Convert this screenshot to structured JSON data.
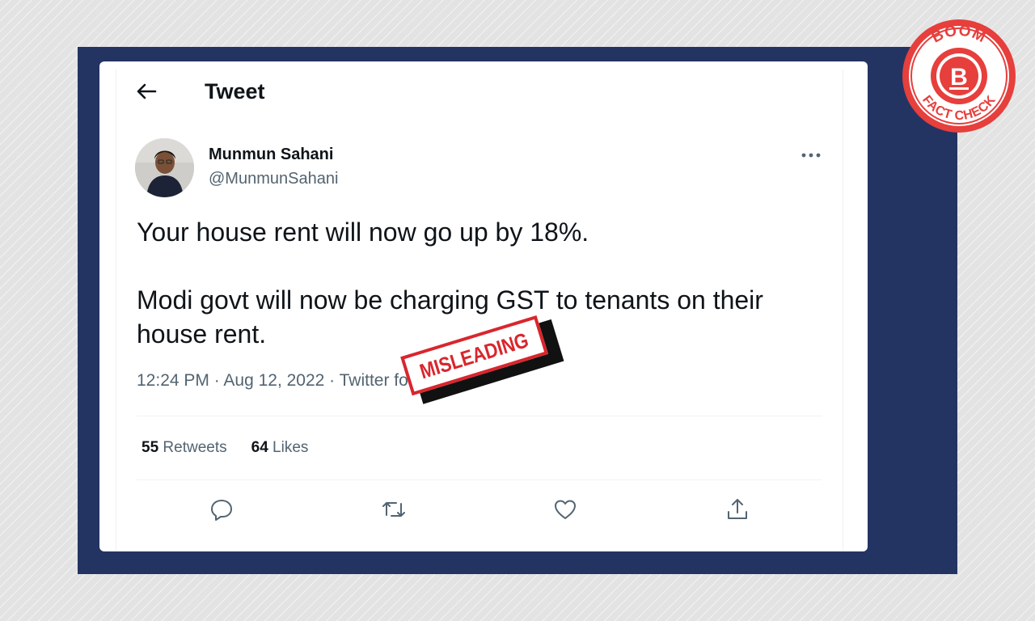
{
  "header": {
    "title": "Tweet"
  },
  "author": {
    "name": "Munmun Sahani",
    "handle": "@MunmunSahani"
  },
  "tweet": {
    "line1": "Your house rent will now go up by 18%.",
    "line2": "Modi govt will now be charging GST to tenants on their house rent.",
    "meta": "12:24 PM · Aug 12, 2022 · Twitter for Android"
  },
  "stats": {
    "retweets_count": "55",
    "retweets_label": "Retweets",
    "likes_count": "64",
    "likes_label": "Likes"
  },
  "stamp": {
    "text": "MISLEADING"
  },
  "badge": {
    "top_text": "BOOM",
    "letter": "B",
    "bottom_text": "FACT CHECK"
  },
  "colors": {
    "frame": "#233463",
    "stamp_red": "#d9262d",
    "badge_red": "#e63f3c",
    "text_primary": "#0f1419",
    "text_secondary": "#536471"
  },
  "icons": [
    "back-arrow-icon",
    "more-dots-icon",
    "reply-icon",
    "retweet-icon",
    "like-icon",
    "share-icon"
  ]
}
